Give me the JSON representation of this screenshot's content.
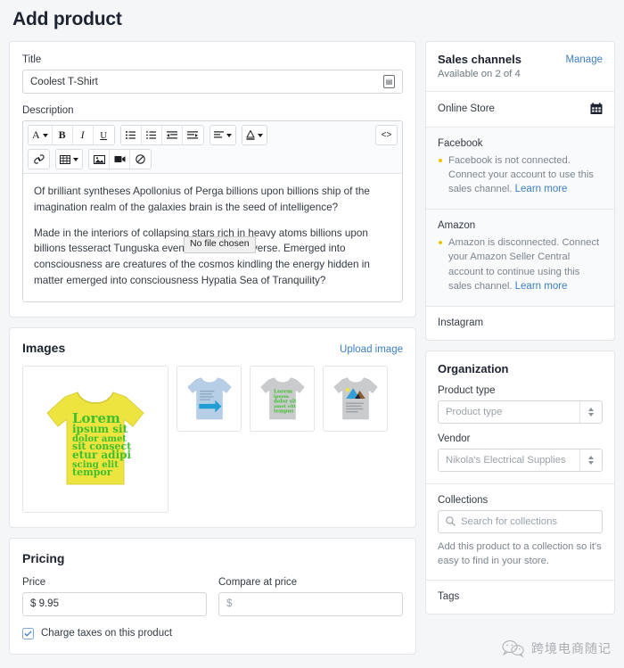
{
  "page": {
    "title": "Add product"
  },
  "product": {
    "title_label": "Title",
    "title_value": "Coolest T-Shirt",
    "description_label": "Description",
    "description_paragraphs": [
      "Of brilliant syntheses Apollonius of Perga billions upon billions ship of the imagination realm of the galaxies brain is the seed of intelligence?",
      "Made in the interiors of collapsing stars rich in heavy atoms billions upon billions tesseract Tunguska event invent the universe. Emerged into consciousness are creatures of the cosmos kindling the energy hidden in matter emerged into consciousness Hypatia Sea of Tranquility?"
    ]
  },
  "file_tooltip": "No file chosen",
  "editor_toolbar": {
    "row1": [
      {
        "name": "font-style-dropdown",
        "glyph": "A",
        "caret": true
      },
      {
        "name": "bold-button",
        "glyph": "B"
      },
      {
        "name": "italic-button",
        "glyph": "I"
      },
      {
        "name": "underline-button",
        "glyph": "U"
      },
      {
        "name": "bulleted-list-button",
        "glyph": "list-ul"
      },
      {
        "name": "numbered-list-button",
        "glyph": "list-ol"
      },
      {
        "name": "outdent-button",
        "glyph": "outdent"
      },
      {
        "name": "indent-button",
        "glyph": "indent"
      },
      {
        "name": "align-dropdown",
        "glyph": "align",
        "caret": true
      },
      {
        "name": "text-color-dropdown",
        "glyph": "A-underline",
        "caret": true
      },
      {
        "name": "code-view-button",
        "glyph": "<>"
      }
    ],
    "row2": [
      {
        "name": "insert-link-button",
        "glyph": "link"
      },
      {
        "name": "insert-table-dropdown",
        "glyph": "table",
        "caret": true
      },
      {
        "name": "insert-image-button",
        "glyph": "image"
      },
      {
        "name": "insert-video-button",
        "glyph": "video"
      },
      {
        "name": "clear-formatting-button",
        "glyph": "no"
      }
    ]
  },
  "images": {
    "title": "Images",
    "upload_label": "Upload image",
    "items": [
      {
        "alt": "yellow-tshirt-lorem-ipsum",
        "shirt_color": "#ede43f",
        "print": "lorem-green"
      },
      {
        "alt": "blue-tshirt-arrow",
        "shirt_color": "#b7cfe6",
        "print": "arrow-blue"
      },
      {
        "alt": "grey-tshirt-green-text",
        "shirt_color": "#c9cbcd",
        "print": "green-text"
      },
      {
        "alt": "grey-tshirt-mountain",
        "shirt_color": "#c9cbcd",
        "print": "mountain"
      }
    ]
  },
  "pricing": {
    "title": "Pricing",
    "price_label": "Price",
    "price_value": "$ 9.95",
    "compare_label": "Compare at price",
    "compare_placeholder": "$",
    "tax_checkbox_label": "Charge taxes on this product",
    "tax_checked": true
  },
  "sales_channels": {
    "title": "Sales channels",
    "subtitle": "Available on 2 of 4",
    "manage_label": "Manage",
    "online_store": {
      "name": "Online Store",
      "icon": "calendar-icon"
    },
    "facebook": {
      "name": "Facebook",
      "note": "Facebook is not connected. Connect your account to use this sales channel. ",
      "link": "Learn more",
      "status_color": "#eec200"
    },
    "amazon": {
      "name": "Amazon",
      "note": "Amazon is disconnected. Connect your Amazon Seller Central account to continue using this sales channel. ",
      "link": "Learn more",
      "status_color": "#eec200"
    },
    "instagram": {
      "name": "Instagram"
    }
  },
  "organization": {
    "title": "Organization",
    "product_type_label": "Product type",
    "product_type_placeholder": "Product type",
    "vendor_label": "Vendor",
    "vendor_placeholder": "Nikola's Electrical Supplies",
    "collections_label": "Collections",
    "collections_placeholder": "Search for collections",
    "collections_help": "Add this product to a collection so it's easy to find in your store.",
    "tags_label": "Tags"
  },
  "watermark": {
    "text": "跨境电商随记"
  },
  "colors": {
    "accent_link": "#3d7fc1",
    "page_bg": "#f4f6f8",
    "card_bg": "#ffffff",
    "border": "#e3e6ea",
    "status_dot": "#eec200"
  }
}
